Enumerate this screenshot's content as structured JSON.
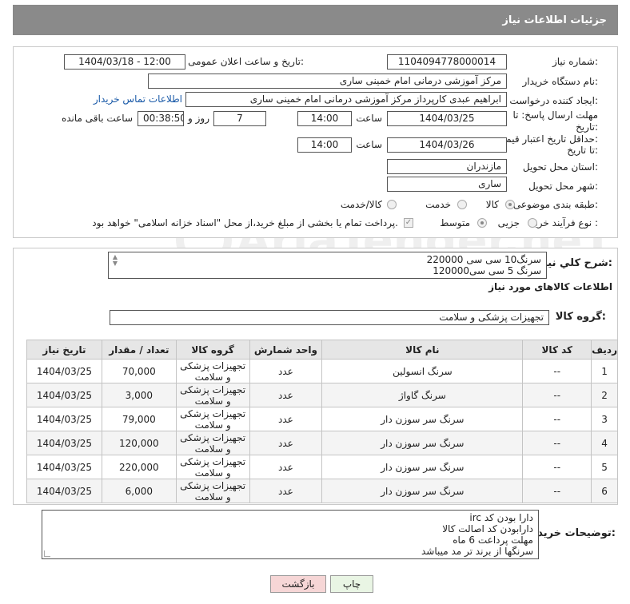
{
  "header": {
    "title": "جزئیات اطلاعات نیاز"
  },
  "form": {
    "need_number_label": "شماره نیاز:",
    "need_number": "1104094778000014",
    "announce_label": "تاریخ و ساعت اعلان عمومی:",
    "announce_value": "1404/03/18 - 12:00",
    "buyer_org_label": "نام دستگاه خریدار:",
    "buyer_org": "مرکز آموزشی درمانی امام خمینی ساری",
    "requester_label": "ایجاد کننده درخواست:",
    "requester": "ابراهیم عبدی کارپرداز مرکز آموزشی درمانی امام خمینی ساری",
    "contact_link": "اطلاعات تماس خریدار",
    "deadline_label_1": "مهلت ارسال پاسخ: تا",
    "deadline_label_2": "تاریخ:",
    "deadline_date": "1404/03/25",
    "time_label": "ساعت",
    "deadline_time": "14:00",
    "days_value": "7",
    "days_label": "روز و",
    "remaining_value": "00:38:50",
    "remaining_label": "ساعت باقی مانده",
    "price_label_1": "حداقل تاریخ اعتبار قیمت:",
    "price_label_2": "تا تاریخ:",
    "price_date": "1404/03/26",
    "price_time": "14:00",
    "province_label": "استان محل تحویل:",
    "province": "مازندران",
    "city_label": "شهر محل تحویل:",
    "city": "ساری",
    "category_label": "طبقه بندی موضوعی:",
    "category_options": [
      "کالا",
      "خدمت",
      "کالا/خدمت"
    ],
    "process_label": "نوع فرآیند خرید :",
    "process_options": [
      "جزیی",
      "متوسط"
    ],
    "payment_note": "پرداخت تمام یا بخشی از مبلغ خرید،از محل \"اسناد خزانه اسلامی\" خواهد بود."
  },
  "summary": {
    "label": "شرح کلي نياز:",
    "line1": "سرنگ10 سی سی 220000",
    "line2": "سرنگ 5 سی سی120000"
  },
  "goods": {
    "section_title": "اطلاعات کالاهای مورد نیاز",
    "group_label": "گروه کالا:",
    "group_value": "تجهیزات پزشکی و سلامت"
  },
  "table": {
    "headers": [
      "ردیف",
      "کد کالا",
      "نام کالا",
      "واحد شمارش",
      "گروه کالا",
      "تعداد / مقدار",
      "تاریخ نیاز"
    ],
    "rows": [
      [
        "1",
        "--",
        "سرنگ انسولین",
        "عدد",
        "تجهیزات پزشکی و سلامت",
        "70,000",
        "1404/03/25"
      ],
      [
        "2",
        "--",
        "سرنگ گاواژ",
        "عدد",
        "تجهیزات پزشکی و سلامت",
        "3,000",
        "1404/03/25"
      ],
      [
        "3",
        "--",
        "سرنگ سر سوزن دار",
        "عدد",
        "تجهیزات پزشکی و سلامت",
        "79,000",
        "1404/03/25"
      ],
      [
        "4",
        "--",
        "سرنگ سر سوزن دار",
        "عدد",
        "تجهیزات پزشکی و سلامت",
        "120,000",
        "1404/03/25"
      ],
      [
        "5",
        "--",
        "سرنگ سر سوزن دار",
        "عدد",
        "تجهیزات پزشکی و سلامت",
        "220,000",
        "1404/03/25"
      ],
      [
        "6",
        "--",
        "سرنگ سر سوزن دار",
        "عدد",
        "تجهیزات پزشکی و سلامت",
        "6,000",
        "1404/03/25"
      ]
    ]
  },
  "buyer_notes": {
    "label": "توضیحات خریدار:",
    "lines": [
      "دارا بودن کد irc",
      "دارابودن کد اصالت کالا",
      "مهلت پرداعت 6 ماه",
      "سرنگها از برند تر مد میباشد"
    ]
  },
  "buttons": {
    "print": "چاپ",
    "back": "بازگشت"
  },
  "watermark": {
    "text": "AriaTender.neT"
  },
  "colors": {
    "titlebar": "#8a8a8a",
    "link": "#1a5aa8",
    "back_button": "#f6d6d6",
    "print_button": "#e9f5e4"
  }
}
